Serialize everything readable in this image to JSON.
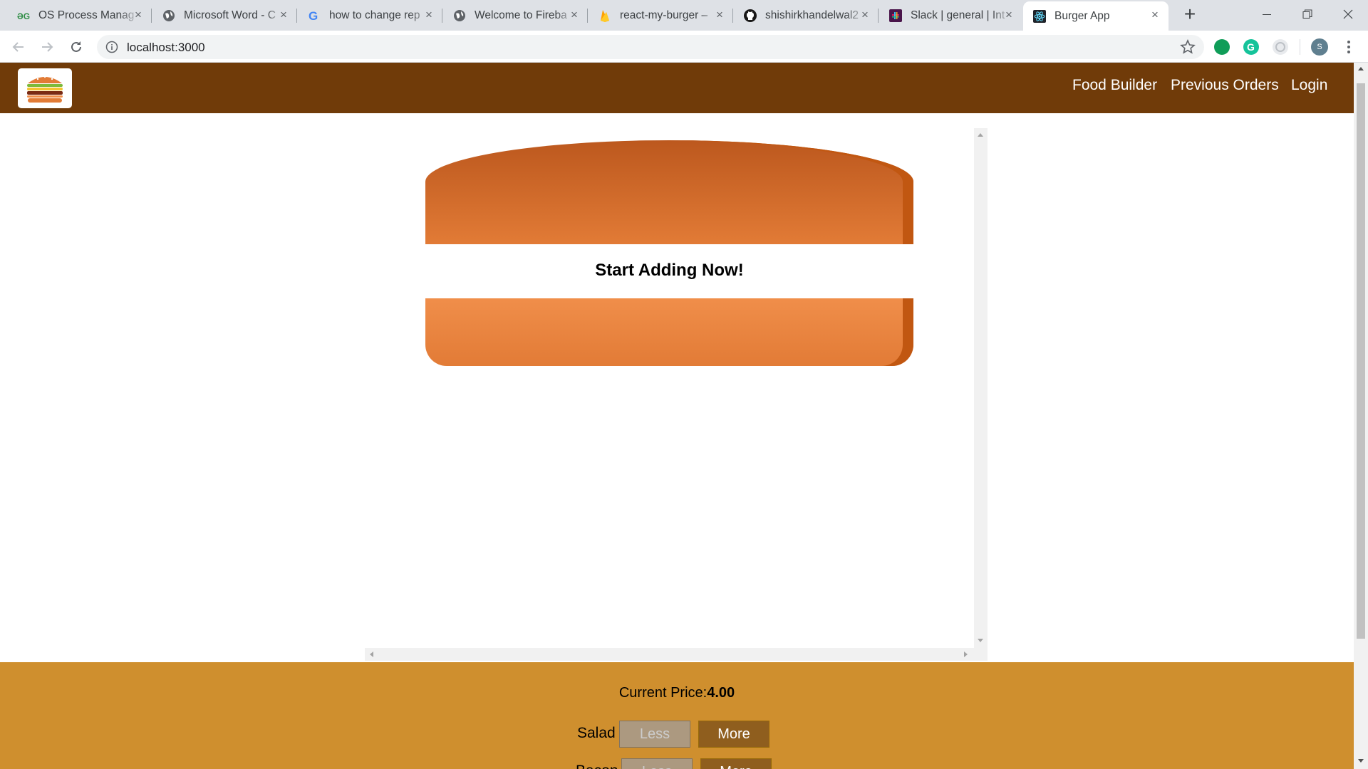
{
  "browser": {
    "tabs": [
      {
        "title": "OS Process Manag",
        "icon": "geeksforgeeks-icon"
      },
      {
        "title": "Microsoft Word - C",
        "icon": "globe-icon"
      },
      {
        "title": "how to change rep",
        "icon": "google-icon"
      },
      {
        "title": "Welcome to Fireba",
        "icon": "globe-icon"
      },
      {
        "title": "react-my-burger –",
        "icon": "firebase-icon"
      },
      {
        "title": "shishirkhandelwal2",
        "icon": "github-icon"
      },
      {
        "title": "Slack | general | Int",
        "icon": "slack-icon"
      },
      {
        "title": "Burger App",
        "icon": "react-icon",
        "active": true
      }
    ],
    "url": "localhost:3000",
    "profile_initial": "S"
  },
  "navbar": {
    "links": [
      "Food Builder",
      "Previous Orders",
      "Login"
    ],
    "bg_color": "#703b09"
  },
  "burger": {
    "message": "Start Adding Now!"
  },
  "controls": {
    "price_label": "Current Price:",
    "price_value": "4.00",
    "rows": [
      {
        "label": "Salad",
        "less": "Less",
        "more": "More"
      },
      {
        "label": "Bacon",
        "less": "Less",
        "more": "More"
      }
    ],
    "bg_color": "#cf8f2e"
  }
}
